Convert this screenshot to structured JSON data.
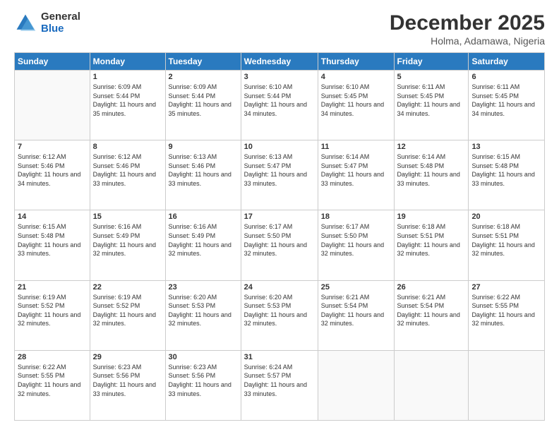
{
  "logo": {
    "general": "General",
    "blue": "Blue"
  },
  "title": "December 2025",
  "location": "Holma, Adamawa, Nigeria",
  "header_days": [
    "Sunday",
    "Monday",
    "Tuesday",
    "Wednesday",
    "Thursday",
    "Friday",
    "Saturday"
  ],
  "weeks": [
    [
      {
        "day": "",
        "sunrise": "",
        "sunset": "",
        "daylight": ""
      },
      {
        "day": "1",
        "sunrise": "Sunrise: 6:09 AM",
        "sunset": "Sunset: 5:44 PM",
        "daylight": "Daylight: 11 hours and 35 minutes."
      },
      {
        "day": "2",
        "sunrise": "Sunrise: 6:09 AM",
        "sunset": "Sunset: 5:44 PM",
        "daylight": "Daylight: 11 hours and 35 minutes."
      },
      {
        "day": "3",
        "sunrise": "Sunrise: 6:10 AM",
        "sunset": "Sunset: 5:44 PM",
        "daylight": "Daylight: 11 hours and 34 minutes."
      },
      {
        "day": "4",
        "sunrise": "Sunrise: 6:10 AM",
        "sunset": "Sunset: 5:45 PM",
        "daylight": "Daylight: 11 hours and 34 minutes."
      },
      {
        "day": "5",
        "sunrise": "Sunrise: 6:11 AM",
        "sunset": "Sunset: 5:45 PM",
        "daylight": "Daylight: 11 hours and 34 minutes."
      },
      {
        "day": "6",
        "sunrise": "Sunrise: 6:11 AM",
        "sunset": "Sunset: 5:45 PM",
        "daylight": "Daylight: 11 hours and 34 minutes."
      }
    ],
    [
      {
        "day": "7",
        "sunrise": "Sunrise: 6:12 AM",
        "sunset": "Sunset: 5:46 PM",
        "daylight": "Daylight: 11 hours and 34 minutes."
      },
      {
        "day": "8",
        "sunrise": "Sunrise: 6:12 AM",
        "sunset": "Sunset: 5:46 PM",
        "daylight": "Daylight: 11 hours and 33 minutes."
      },
      {
        "day": "9",
        "sunrise": "Sunrise: 6:13 AM",
        "sunset": "Sunset: 5:46 PM",
        "daylight": "Daylight: 11 hours and 33 minutes."
      },
      {
        "day": "10",
        "sunrise": "Sunrise: 6:13 AM",
        "sunset": "Sunset: 5:47 PM",
        "daylight": "Daylight: 11 hours and 33 minutes."
      },
      {
        "day": "11",
        "sunrise": "Sunrise: 6:14 AM",
        "sunset": "Sunset: 5:47 PM",
        "daylight": "Daylight: 11 hours and 33 minutes."
      },
      {
        "day": "12",
        "sunrise": "Sunrise: 6:14 AM",
        "sunset": "Sunset: 5:48 PM",
        "daylight": "Daylight: 11 hours and 33 minutes."
      },
      {
        "day": "13",
        "sunrise": "Sunrise: 6:15 AM",
        "sunset": "Sunset: 5:48 PM",
        "daylight": "Daylight: 11 hours and 33 minutes."
      }
    ],
    [
      {
        "day": "14",
        "sunrise": "Sunrise: 6:15 AM",
        "sunset": "Sunset: 5:48 PM",
        "daylight": "Daylight: 11 hours and 33 minutes."
      },
      {
        "day": "15",
        "sunrise": "Sunrise: 6:16 AM",
        "sunset": "Sunset: 5:49 PM",
        "daylight": "Daylight: 11 hours and 32 minutes."
      },
      {
        "day": "16",
        "sunrise": "Sunrise: 6:16 AM",
        "sunset": "Sunset: 5:49 PM",
        "daylight": "Daylight: 11 hours and 32 minutes."
      },
      {
        "day": "17",
        "sunrise": "Sunrise: 6:17 AM",
        "sunset": "Sunset: 5:50 PM",
        "daylight": "Daylight: 11 hours and 32 minutes."
      },
      {
        "day": "18",
        "sunrise": "Sunrise: 6:17 AM",
        "sunset": "Sunset: 5:50 PM",
        "daylight": "Daylight: 11 hours and 32 minutes."
      },
      {
        "day": "19",
        "sunrise": "Sunrise: 6:18 AM",
        "sunset": "Sunset: 5:51 PM",
        "daylight": "Daylight: 11 hours and 32 minutes."
      },
      {
        "day": "20",
        "sunrise": "Sunrise: 6:18 AM",
        "sunset": "Sunset: 5:51 PM",
        "daylight": "Daylight: 11 hours and 32 minutes."
      }
    ],
    [
      {
        "day": "21",
        "sunrise": "Sunrise: 6:19 AM",
        "sunset": "Sunset: 5:52 PM",
        "daylight": "Daylight: 11 hours and 32 minutes."
      },
      {
        "day": "22",
        "sunrise": "Sunrise: 6:19 AM",
        "sunset": "Sunset: 5:52 PM",
        "daylight": "Daylight: 11 hours and 32 minutes."
      },
      {
        "day": "23",
        "sunrise": "Sunrise: 6:20 AM",
        "sunset": "Sunset: 5:53 PM",
        "daylight": "Daylight: 11 hours and 32 minutes."
      },
      {
        "day": "24",
        "sunrise": "Sunrise: 6:20 AM",
        "sunset": "Sunset: 5:53 PM",
        "daylight": "Daylight: 11 hours and 32 minutes."
      },
      {
        "day": "25",
        "sunrise": "Sunrise: 6:21 AM",
        "sunset": "Sunset: 5:54 PM",
        "daylight": "Daylight: 11 hours and 32 minutes."
      },
      {
        "day": "26",
        "sunrise": "Sunrise: 6:21 AM",
        "sunset": "Sunset: 5:54 PM",
        "daylight": "Daylight: 11 hours and 32 minutes."
      },
      {
        "day": "27",
        "sunrise": "Sunrise: 6:22 AM",
        "sunset": "Sunset: 5:55 PM",
        "daylight": "Daylight: 11 hours and 32 minutes."
      }
    ],
    [
      {
        "day": "28",
        "sunrise": "Sunrise: 6:22 AM",
        "sunset": "Sunset: 5:55 PM",
        "daylight": "Daylight: 11 hours and 32 minutes."
      },
      {
        "day": "29",
        "sunrise": "Sunrise: 6:23 AM",
        "sunset": "Sunset: 5:56 PM",
        "daylight": "Daylight: 11 hours and 33 minutes."
      },
      {
        "day": "30",
        "sunrise": "Sunrise: 6:23 AM",
        "sunset": "Sunset: 5:56 PM",
        "daylight": "Daylight: 11 hours and 33 minutes."
      },
      {
        "day": "31",
        "sunrise": "Sunrise: 6:24 AM",
        "sunset": "Sunset: 5:57 PM",
        "daylight": "Daylight: 11 hours and 33 minutes."
      },
      {
        "day": "",
        "sunrise": "",
        "sunset": "",
        "daylight": ""
      },
      {
        "day": "",
        "sunrise": "",
        "sunset": "",
        "daylight": ""
      },
      {
        "day": "",
        "sunrise": "",
        "sunset": "",
        "daylight": ""
      }
    ]
  ]
}
